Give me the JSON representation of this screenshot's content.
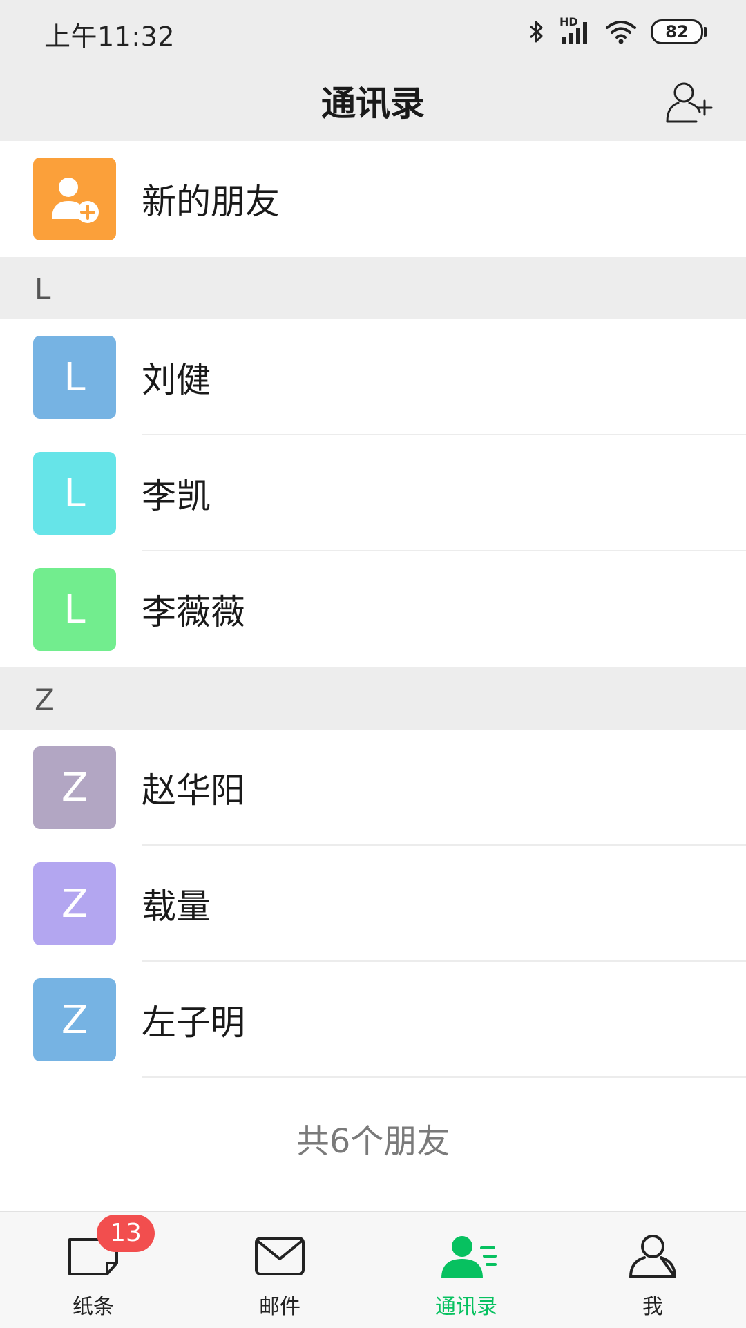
{
  "status_bar": {
    "time": "上午11:32",
    "battery": "82",
    "network": "HD"
  },
  "header": {
    "title": "通讯录"
  },
  "new_friends": {
    "label": "新的朋友",
    "color": "#fba03a"
  },
  "sections": [
    {
      "letter": "L",
      "contacts": [
        {
          "name": "刘健",
          "initial": "L",
          "color": "#76b3e3"
        },
        {
          "name": "李凯",
          "initial": "L",
          "color": "#66e4e8"
        },
        {
          "name": "李薇薇",
          "initial": "L",
          "color": "#72ed8e"
        }
      ]
    },
    {
      "letter": "Z",
      "contacts": [
        {
          "name": "赵华阳",
          "initial": "Z",
          "color": "#b2a6c3"
        },
        {
          "name": "载量",
          "initial": "Z",
          "color": "#b3a6f0"
        },
        {
          "name": "左子明",
          "initial": "Z",
          "color": "#76b3e3"
        }
      ]
    }
  ],
  "footer": {
    "friend_count": "共6个朋友"
  },
  "bottom_nav": {
    "items": [
      {
        "label": "纸条",
        "icon": "note-icon",
        "badge": "13"
      },
      {
        "label": "邮件",
        "icon": "mail-icon"
      },
      {
        "label": "通讯录",
        "icon": "contacts-icon"
      },
      {
        "label": "我",
        "icon": "profile-icon"
      }
    ],
    "active_color": "#07c160"
  }
}
